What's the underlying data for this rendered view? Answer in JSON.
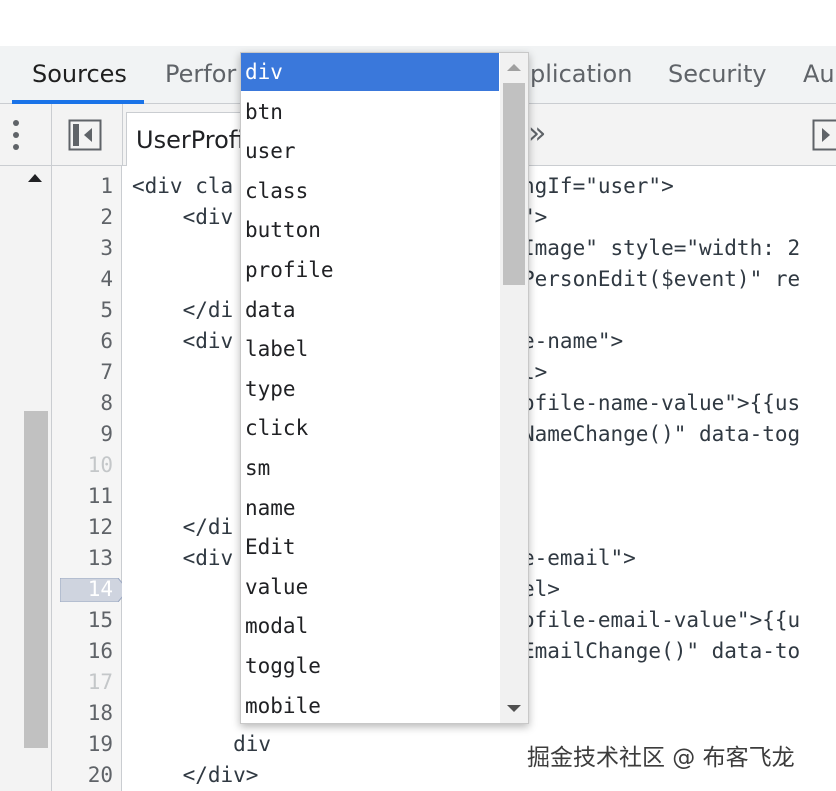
{
  "tabs": [
    {
      "label": "Sources",
      "active": true
    },
    {
      "label": "Perfor",
      "active": false
    },
    {
      "label": "plication",
      "active": false
    },
    {
      "label": "Security",
      "active": false
    },
    {
      "label": "Au",
      "active": false
    }
  ],
  "toolbar": {
    "file_tab_label": "UserProfi",
    "more_tabs_glyph": "»"
  },
  "icons": {
    "menu": "kebab-menu-icon",
    "navigator_toggle": "navigator-toggle-icon",
    "debugger_toggle": "debugger-toggle-icon",
    "more_tabs": "double-chevron-right-icon"
  },
  "gutter": {
    "line_numbers": [
      "1",
      "2",
      "3",
      "4",
      "5",
      "6",
      "7",
      "8",
      "9",
      "10",
      "11",
      "12",
      "13",
      "14",
      "15",
      "16",
      "17",
      "18",
      "19",
      "20"
    ],
    "dim_lines": [
      10,
      17
    ],
    "breakpoint_line": 14
  },
  "code": {
    "left": [
      "<div cla",
      "    <div",
      "",
      "",
      "    </di",
      "    <div",
      "",
      "",
      "",
      "",
      "",
      "    </di",
      "    <div",
      "",
      "",
      "",
      "",
      "",
      "        div",
      "    </div>"
    ],
    "right": [
      "ngIf=\"user\">",
      "\">",
      "Image\" style=\"width: 2",
      "PersonEdit($event)\" re",
      "",
      "e-name\">",
      "l>",
      "ofile-name-value\">{{us",
      "NameChange()\" data-tog",
      "",
      "",
      "",
      "e-email\">",
      "el>",
      "ofile-email-value\">{{u",
      "EmailChange()\" data-to",
      "",
      "",
      "",
      ""
    ]
  },
  "autocomplete": {
    "selected_index": 0,
    "items": [
      "div",
      "btn",
      "user",
      "class",
      "button",
      "profile",
      "data",
      "label",
      "type",
      "click",
      "sm",
      "name",
      "Edit",
      "value",
      "modal",
      "toggle",
      "mobile"
    ]
  },
  "colors": {
    "selection": "#3a78db",
    "tab_underline": "#1a73e8"
  },
  "watermark": "掘金技术社区 @ 布客飞龙"
}
